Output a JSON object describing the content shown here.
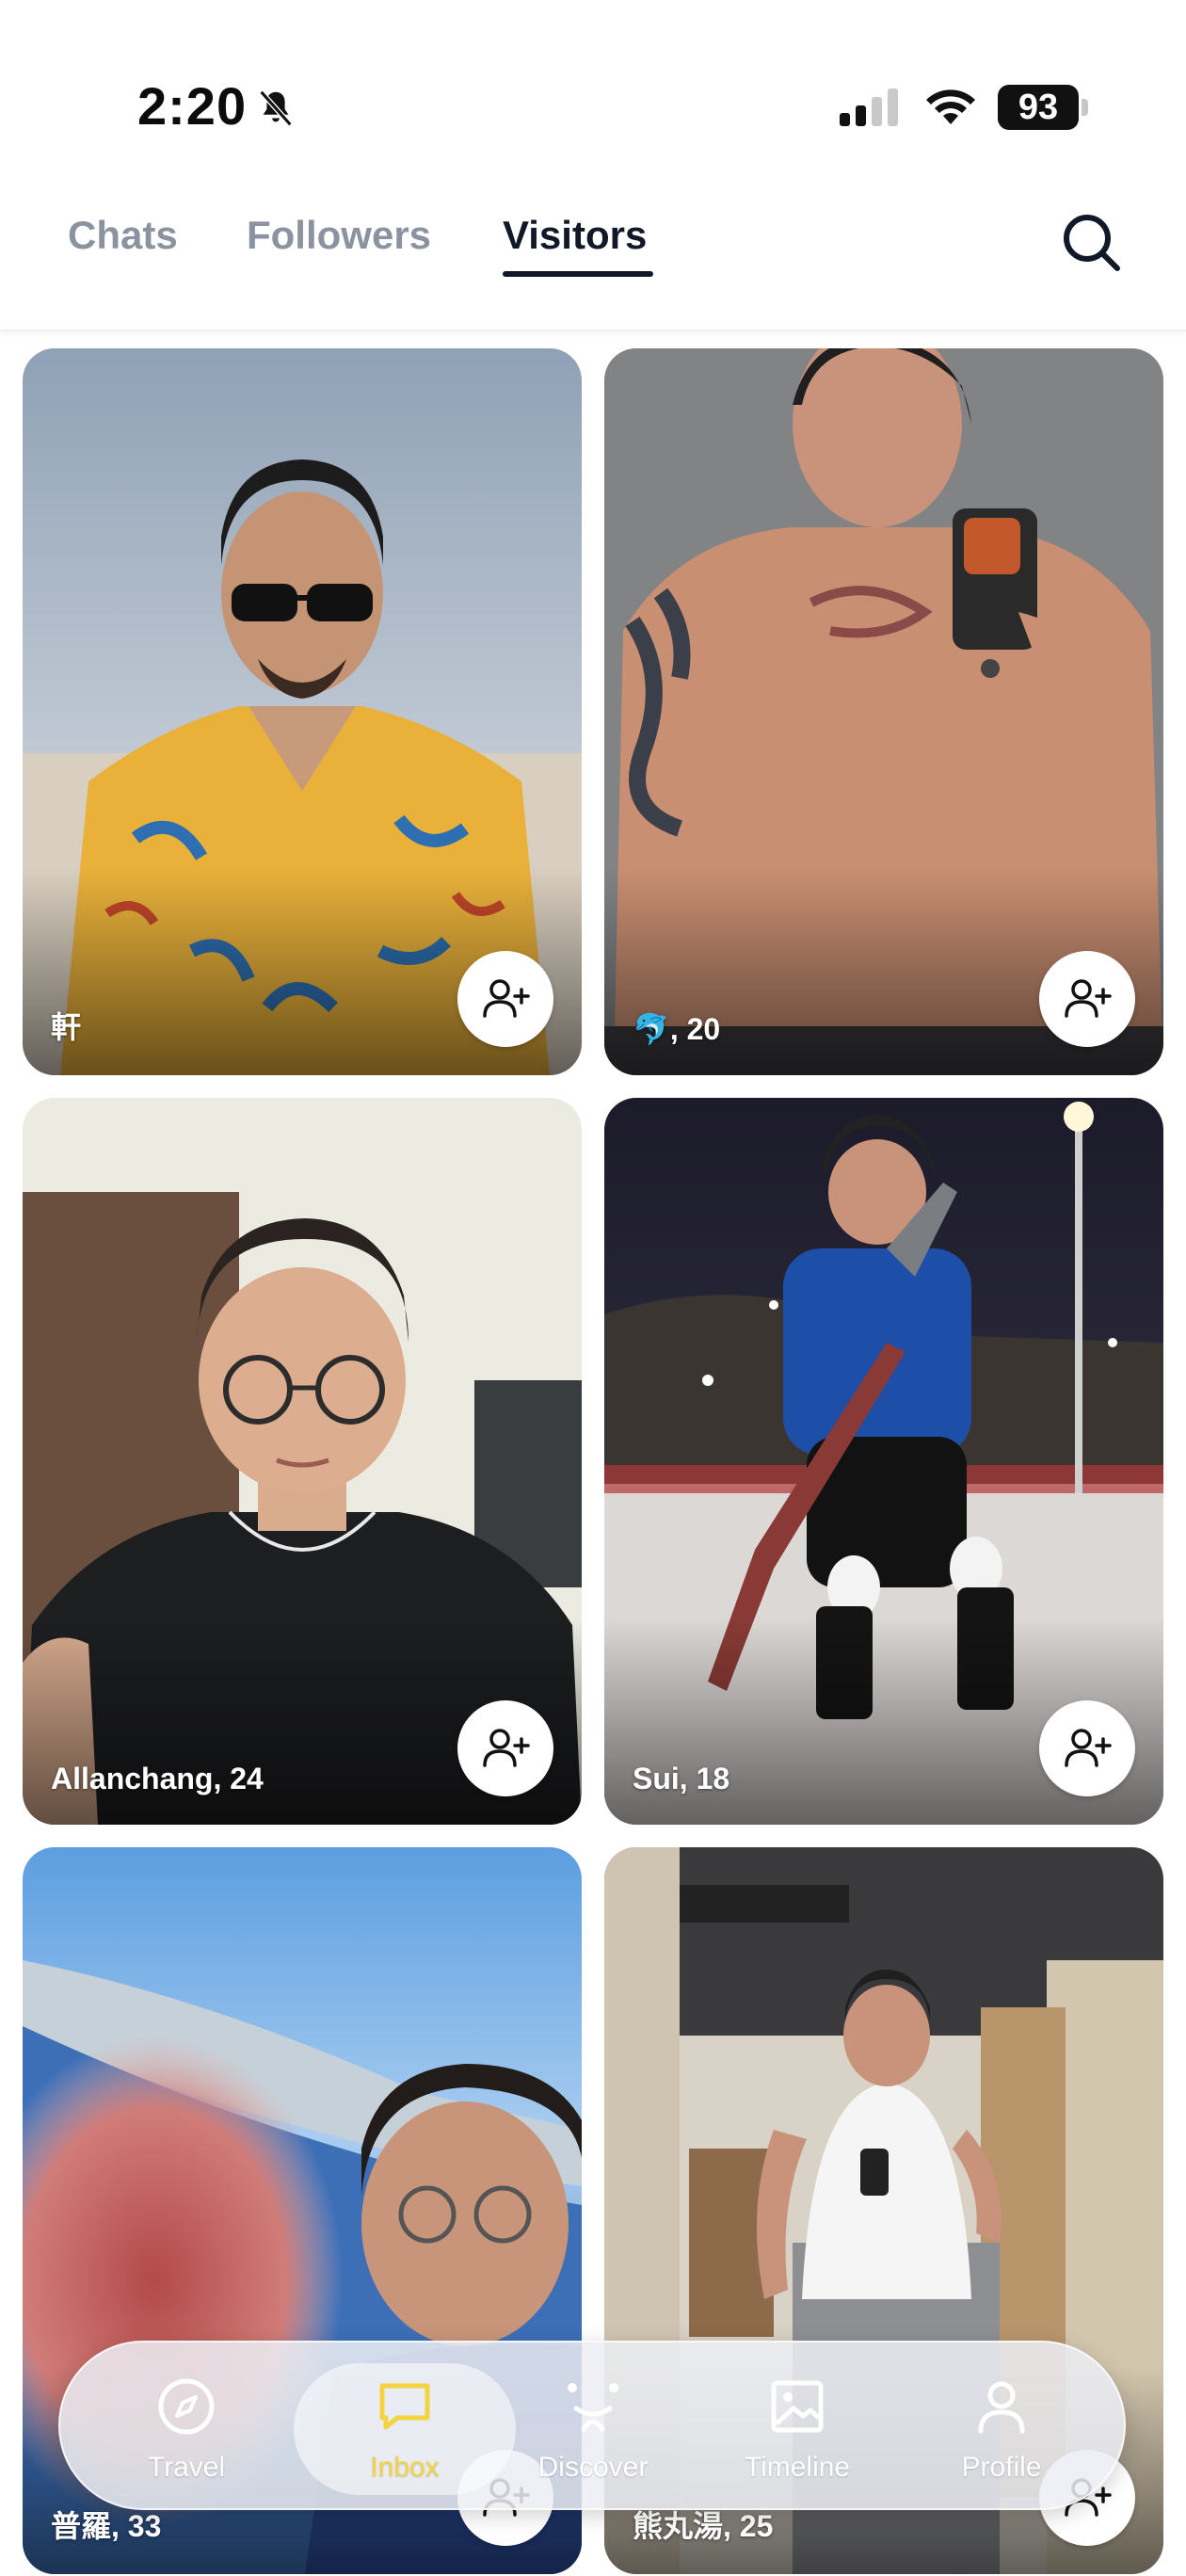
{
  "status_bar": {
    "time": "2:20",
    "battery": "93",
    "icons": [
      "bell-slash-icon",
      "cellular-signal-icon",
      "wifi-icon",
      "battery-icon"
    ]
  },
  "tabs": [
    {
      "label": "Chats",
      "active": false
    },
    {
      "label": "Followers",
      "active": false
    },
    {
      "label": "Visitors",
      "active": true
    }
  ],
  "search_icon": "search-icon",
  "visitors": [
    {
      "name": "軒",
      "photo": "man in yellow floral shirt with sunglasses, cloudy sky"
    },
    {
      "name": "🐬, 20",
      "photo": "shirtless mirror selfie with tattoo"
    },
    {
      "name": "Allanchang, 24",
      "photo": "man with glasses in black sleeveless shirt"
    },
    {
      "name": "Sui, 18",
      "photo": "snowboarder in blue hoodie at night ski slope"
    },
    {
      "name": "普羅, 33",
      "photo": "selfie with glasses, sea and sky background"
    },
    {
      "name": "熊丸湯, 25",
      "photo": "mirror selfie in white tank top"
    }
  ],
  "bottom_nav": [
    {
      "label": "Travel",
      "icon": "compass-icon",
      "active": false
    },
    {
      "label": "Inbox",
      "icon": "chat-bubble-icon",
      "active": true
    },
    {
      "label": "Discover",
      "icon": "discover-face-icon",
      "active": false
    },
    {
      "label": "Timeline",
      "icon": "image-icon",
      "active": false
    },
    {
      "label": "Profile",
      "icon": "person-icon",
      "active": false
    }
  ],
  "colors": {
    "active_tab": "#111827",
    "inactive_tab": "#8b92a0",
    "inbox_active": "#f3d33f"
  }
}
